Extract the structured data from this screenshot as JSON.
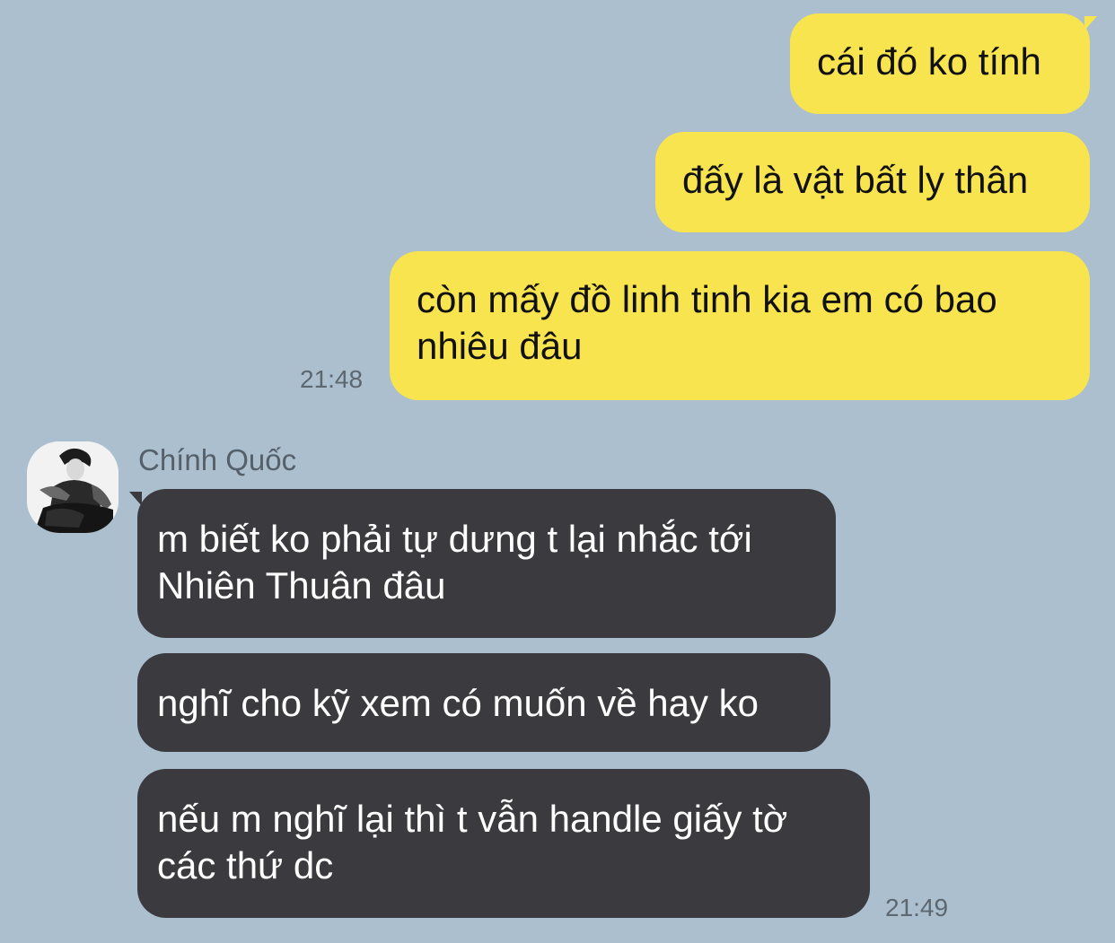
{
  "colors": {
    "background": "#abbfcf",
    "outgoing_bubble": "#f8e44e",
    "incoming_bubble": "#3b3b3f"
  },
  "outgoing": {
    "messages": [
      "cái đó ko tính",
      "đấy là vật bất ly thân",
      "còn mấy đồ linh tinh kia em có bao\nnhiêu đâu"
    ],
    "time": "21:48"
  },
  "incoming": {
    "sender_name": "Chính Quốc",
    "avatar_icon": "avatar-photo",
    "messages": [
      "m biết ko phải tự dưng t lại nhắc tới\nNhiên Thuân đâu",
      "nghĩ cho kỹ xem có muốn về hay ko",
      "nếu m nghĩ lại thì t vẫn handle giấy tờ\ncác thứ dc"
    ],
    "time": "21:49"
  }
}
